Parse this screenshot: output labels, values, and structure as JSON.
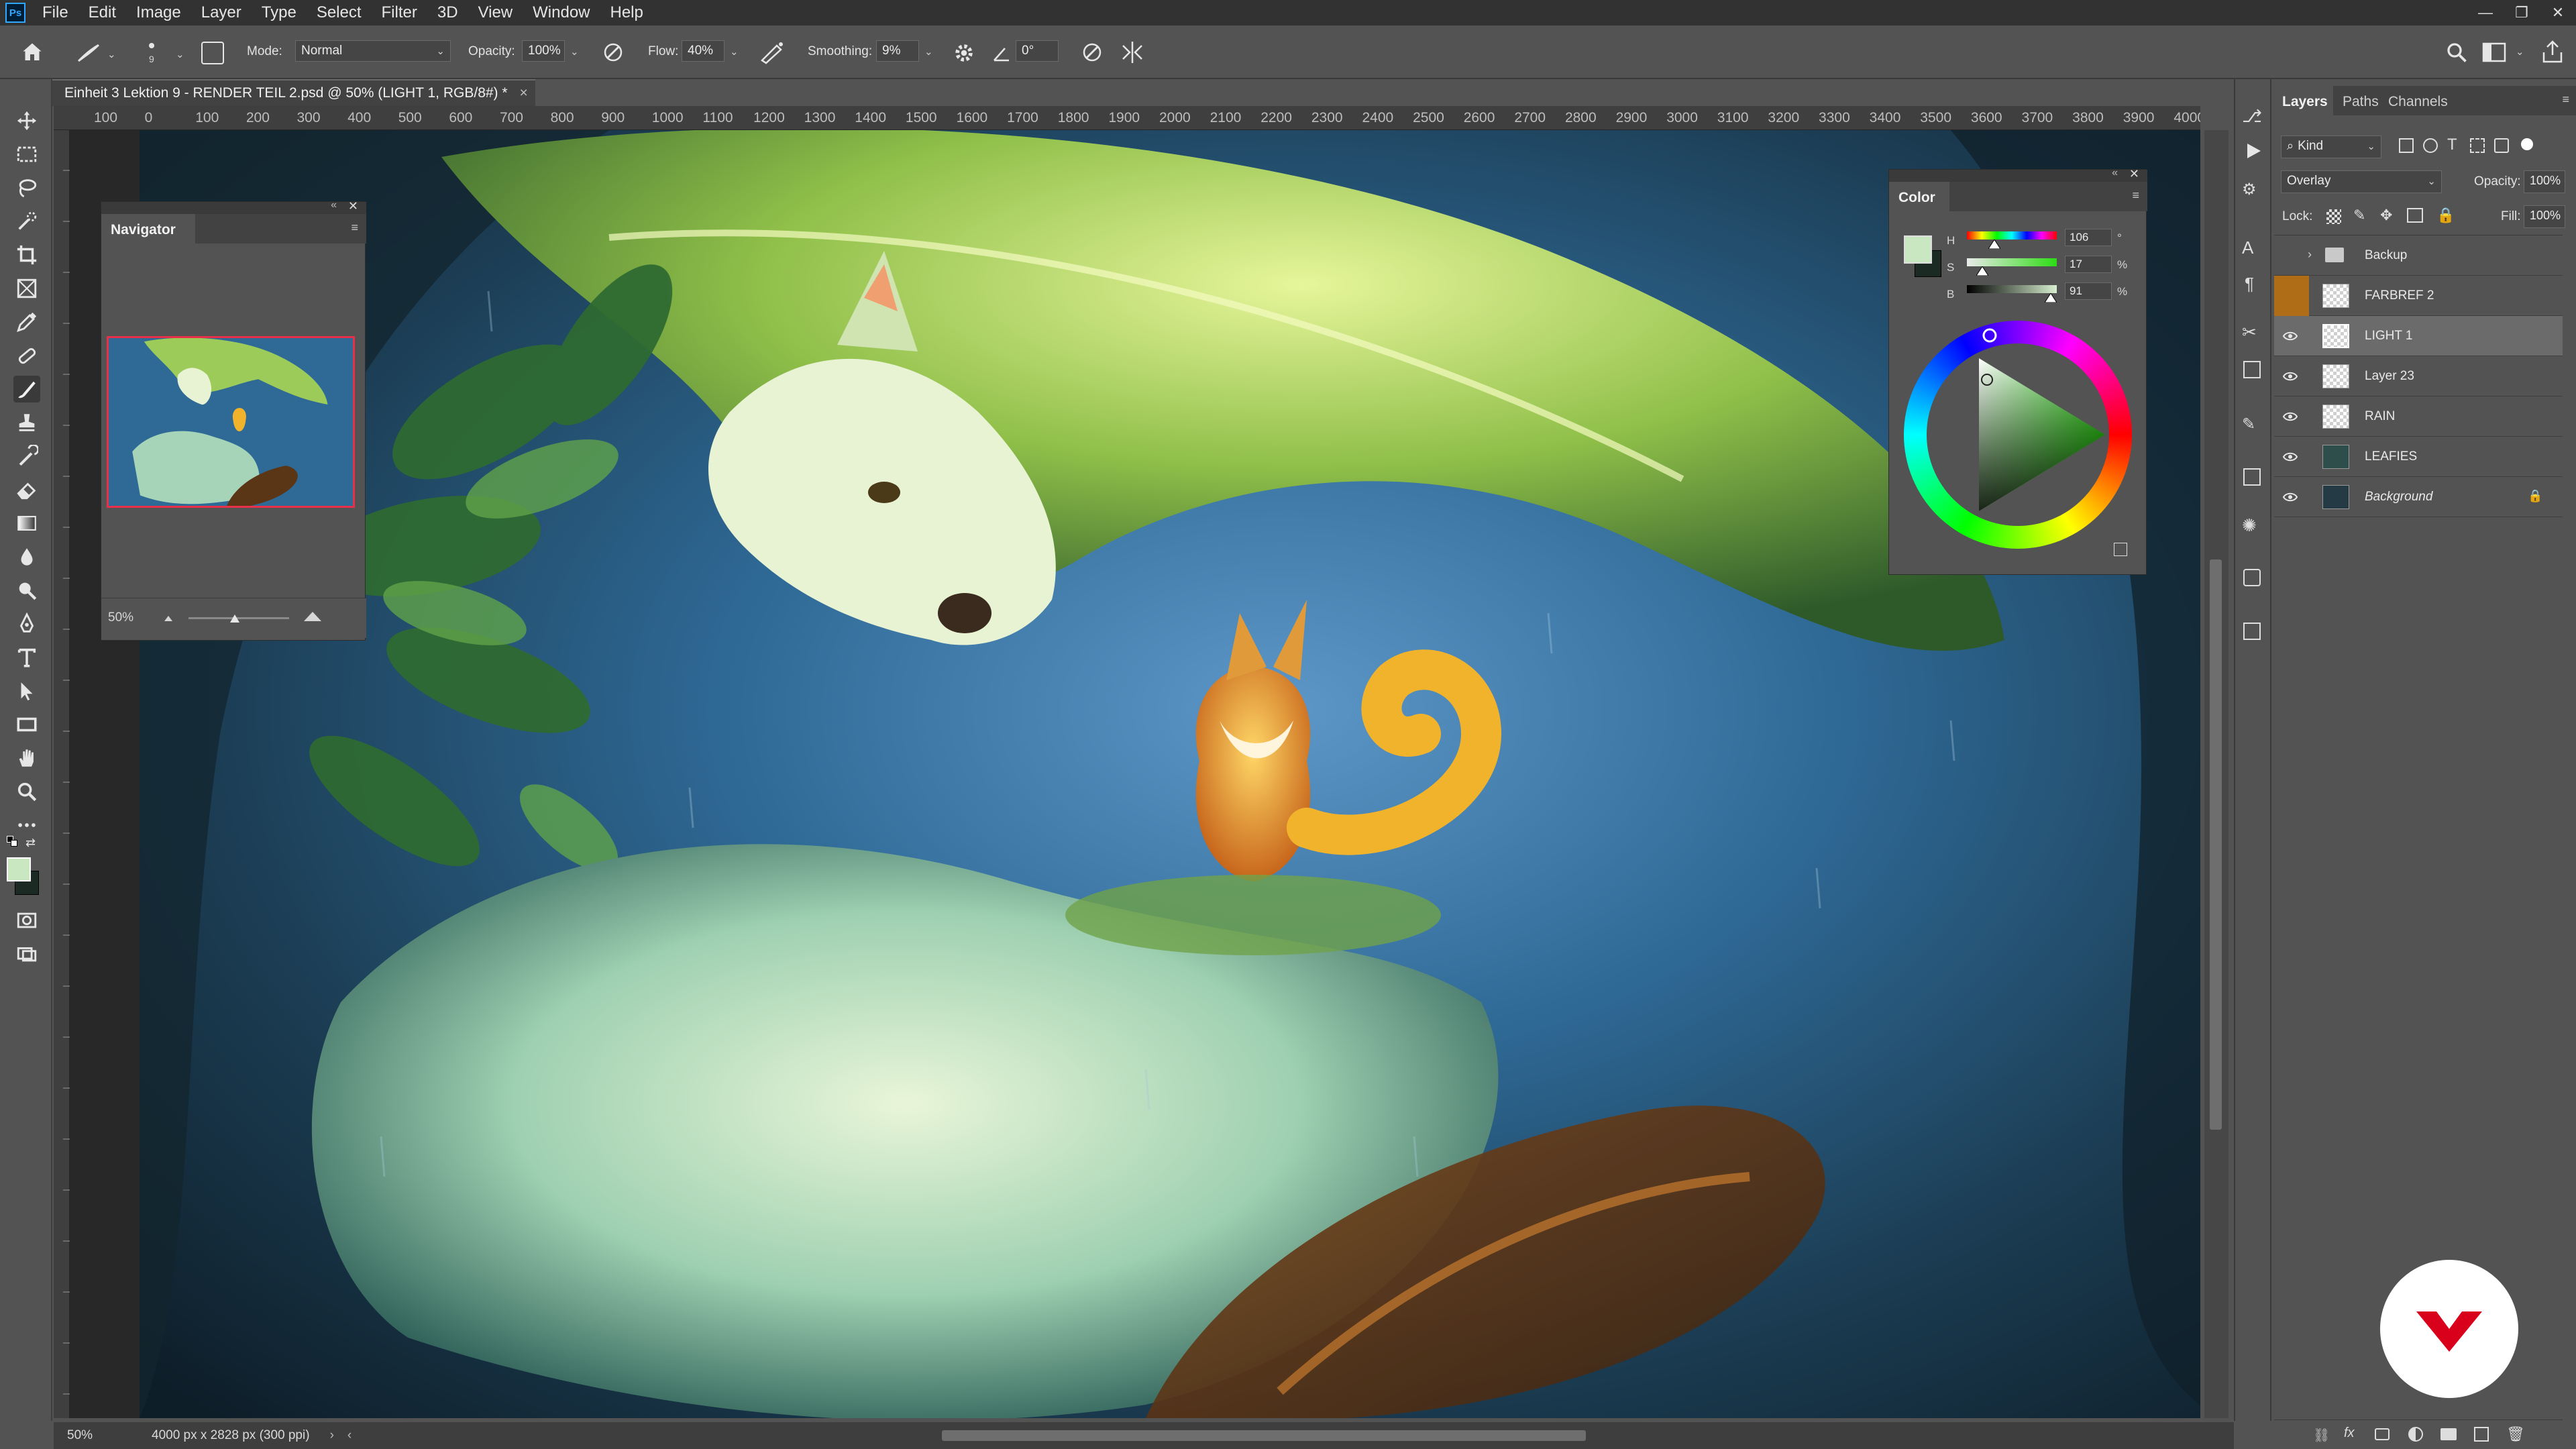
{
  "app": {
    "logo": "Ps",
    "menu": [
      "File",
      "Edit",
      "Image",
      "Layer",
      "Type",
      "Select",
      "Filter",
      "3D",
      "View",
      "Window",
      "Help"
    ]
  },
  "options_bar": {
    "brush_size": "9",
    "mode_label": "Mode:",
    "mode_value": "Normal",
    "opacity_label": "Opacity:",
    "opacity_value": "100%",
    "flow_label": "Flow:",
    "flow_value": "40%",
    "smoothing_label": "Smoothing:",
    "smoothing_value": "9%",
    "angle_value": "0°"
  },
  "document": {
    "tab_title": "Einheit 3 Lektion 9 - RENDER TEIL 2.psd @ 50% (LIGHT 1, RGB/8#) *",
    "close": "×"
  },
  "ruler": {
    "ticks": [
      "100",
      "0",
      "100",
      "200",
      "300",
      "400",
      "500",
      "600",
      "700",
      "800",
      "900",
      "1000",
      "1100",
      "1200",
      "1300",
      "1400",
      "1500",
      "1600",
      "1700",
      "1800",
      "1900",
      "2000",
      "2100",
      "2200",
      "2300",
      "2400",
      "2500",
      "2600",
      "2700",
      "2800",
      "2900",
      "3000",
      "3100",
      "3200",
      "3300",
      "3400",
      "3500",
      "3600",
      "3700",
      "3800",
      "3900",
      "4000"
    ]
  },
  "navigator": {
    "title": "Navigator",
    "zoom": "50%"
  },
  "color_panel": {
    "title": "Color",
    "h_label": "H",
    "h_value": "106",
    "h_unit": "°",
    "s_label": "S",
    "s_value": "17",
    "s_unit": "%",
    "b_label": "B",
    "b_value": "91",
    "b_unit": "%",
    "foreground_color": "#c9e8c2",
    "background_color": "#1c2a24"
  },
  "layers_panel": {
    "tabs": [
      "Layers",
      "Paths",
      "Channels"
    ],
    "filter_kind": "Kind",
    "blend_mode": "Overlay",
    "opacity_label": "Opacity:",
    "opacity_value": "100%",
    "lock_label": "Lock:",
    "fill_label": "Fill:",
    "fill_value": "100%",
    "layers": [
      {
        "name": "Backup",
        "type": "group",
        "visible": false
      },
      {
        "name": "FARBREF 2",
        "type": "layer",
        "visible": false
      },
      {
        "name": "LIGHT 1",
        "type": "layer",
        "visible": true,
        "selected": true
      },
      {
        "name": "Layer 23",
        "type": "layer",
        "visible": true
      },
      {
        "name": "RAIN",
        "type": "layer",
        "visible": true
      },
      {
        "name": "LEAFIES",
        "type": "layer",
        "visible": true
      },
      {
        "name": "Background",
        "type": "background",
        "visible": true,
        "locked": true
      }
    ]
  },
  "status_bar": {
    "zoom": "50%",
    "doc_info": "4000 px x 2828 px (300 ppi)"
  },
  "colors": {
    "accent_red": "#d9001b",
    "selection_blue": "#31a8ff"
  }
}
